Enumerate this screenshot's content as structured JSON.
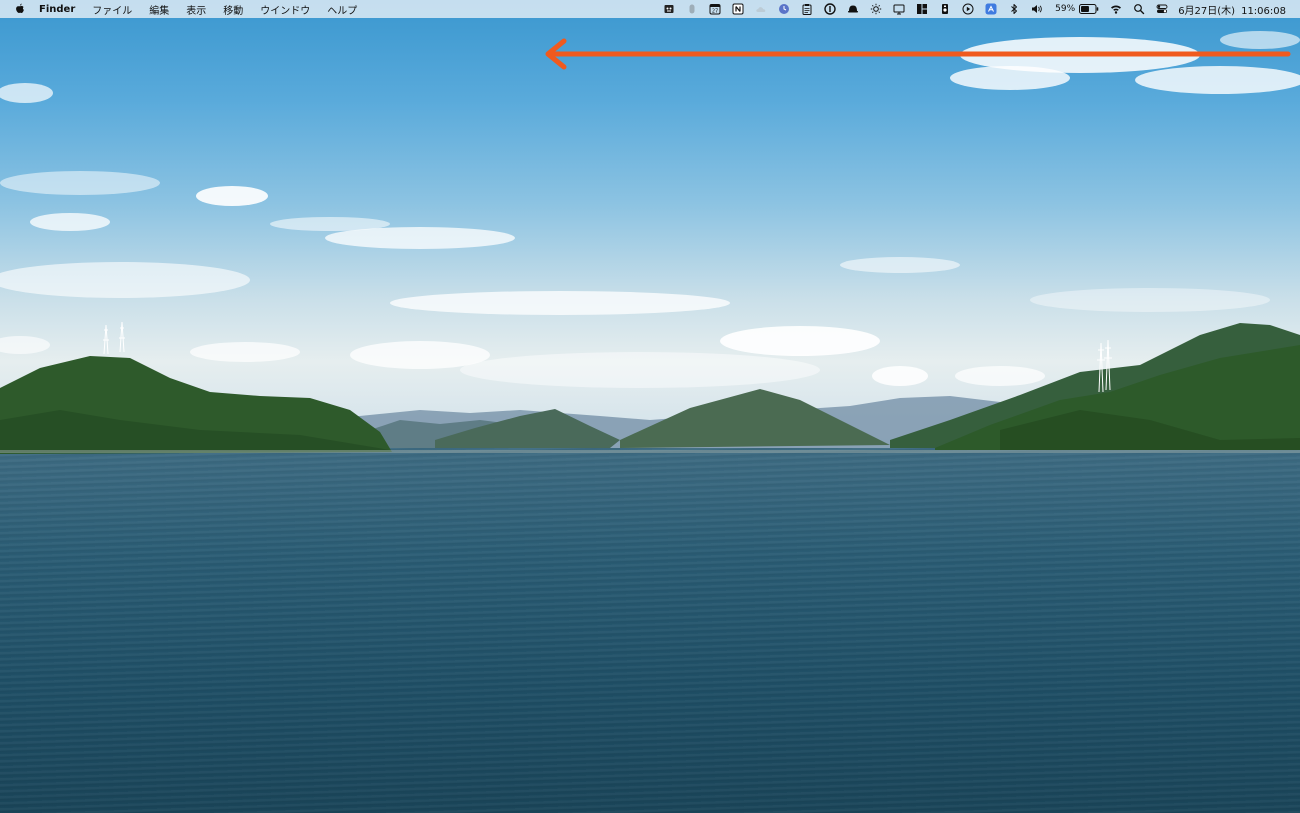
{
  "menubar": {
    "app_name": "Finder",
    "menus": [
      "ファイル",
      "編集",
      "表示",
      "移動",
      "ウインドウ",
      "ヘルプ"
    ],
    "status_icons": [
      "robot-icon",
      "mouse-icon",
      "calendar-icon",
      "notion-icon",
      "cloud-icon",
      "clock-icon",
      "clipboard-icon",
      "onepassword-icon",
      "hat-icon",
      "brightness-icon",
      "display-icon",
      "layout-icon",
      "stopwatch-icon",
      "play-icon",
      "app-icon",
      "bluetooth-icon",
      "volume-icon"
    ],
    "calendar_badge": "27",
    "battery_percent": "59%",
    "battery_level": 0.59,
    "date": "6月27日(木)",
    "time": "11:06:08",
    "control_icons": [
      "wifi-icon",
      "search-icon",
      "control-center-icon"
    ]
  },
  "annotation": {
    "arrow_color": "#f05a1e",
    "arrow_direction": "left"
  },
  "colors": {
    "menubar_bg": "#e8f0f6",
    "sea": "#245a72",
    "hill": "#2f5a2e"
  }
}
